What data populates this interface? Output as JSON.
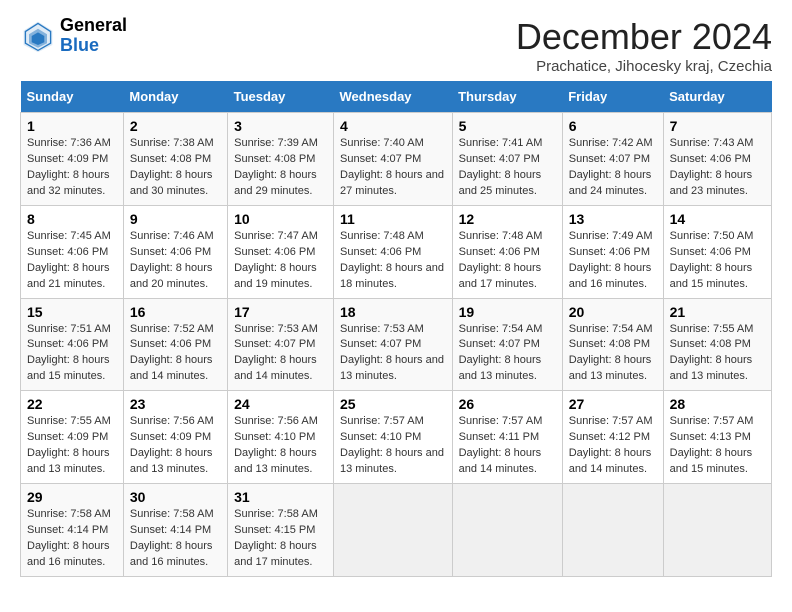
{
  "header": {
    "logo_general": "General",
    "logo_blue": "Blue",
    "month_title": "December 2024",
    "subtitle": "Prachatice, Jihocesky kraj, Czechia"
  },
  "calendar": {
    "days_of_week": [
      "Sunday",
      "Monday",
      "Tuesday",
      "Wednesday",
      "Thursday",
      "Friday",
      "Saturday"
    ],
    "weeks": [
      [
        {
          "day": "1",
          "sunrise": "Sunrise: 7:36 AM",
          "sunset": "Sunset: 4:09 PM",
          "daylight": "Daylight: 8 hours and 32 minutes."
        },
        {
          "day": "2",
          "sunrise": "Sunrise: 7:38 AM",
          "sunset": "Sunset: 4:08 PM",
          "daylight": "Daylight: 8 hours and 30 minutes."
        },
        {
          "day": "3",
          "sunrise": "Sunrise: 7:39 AM",
          "sunset": "Sunset: 4:08 PM",
          "daylight": "Daylight: 8 hours and 29 minutes."
        },
        {
          "day": "4",
          "sunrise": "Sunrise: 7:40 AM",
          "sunset": "Sunset: 4:07 PM",
          "daylight": "Daylight: 8 hours and 27 minutes."
        },
        {
          "day": "5",
          "sunrise": "Sunrise: 7:41 AM",
          "sunset": "Sunset: 4:07 PM",
          "daylight": "Daylight: 8 hours and 25 minutes."
        },
        {
          "day": "6",
          "sunrise": "Sunrise: 7:42 AM",
          "sunset": "Sunset: 4:07 PM",
          "daylight": "Daylight: 8 hours and 24 minutes."
        },
        {
          "day": "7",
          "sunrise": "Sunrise: 7:43 AM",
          "sunset": "Sunset: 4:06 PM",
          "daylight": "Daylight: 8 hours and 23 minutes."
        }
      ],
      [
        {
          "day": "8",
          "sunrise": "Sunrise: 7:45 AM",
          "sunset": "Sunset: 4:06 PM",
          "daylight": "Daylight: 8 hours and 21 minutes."
        },
        {
          "day": "9",
          "sunrise": "Sunrise: 7:46 AM",
          "sunset": "Sunset: 4:06 PM",
          "daylight": "Daylight: 8 hours and 20 minutes."
        },
        {
          "day": "10",
          "sunrise": "Sunrise: 7:47 AM",
          "sunset": "Sunset: 4:06 PM",
          "daylight": "Daylight: 8 hours and 19 minutes."
        },
        {
          "day": "11",
          "sunrise": "Sunrise: 7:48 AM",
          "sunset": "Sunset: 4:06 PM",
          "daylight": "Daylight: 8 hours and 18 minutes."
        },
        {
          "day": "12",
          "sunrise": "Sunrise: 7:48 AM",
          "sunset": "Sunset: 4:06 PM",
          "daylight": "Daylight: 8 hours and 17 minutes."
        },
        {
          "day": "13",
          "sunrise": "Sunrise: 7:49 AM",
          "sunset": "Sunset: 4:06 PM",
          "daylight": "Daylight: 8 hours and 16 minutes."
        },
        {
          "day": "14",
          "sunrise": "Sunrise: 7:50 AM",
          "sunset": "Sunset: 4:06 PM",
          "daylight": "Daylight: 8 hours and 15 minutes."
        }
      ],
      [
        {
          "day": "15",
          "sunrise": "Sunrise: 7:51 AM",
          "sunset": "Sunset: 4:06 PM",
          "daylight": "Daylight: 8 hours and 15 minutes."
        },
        {
          "day": "16",
          "sunrise": "Sunrise: 7:52 AM",
          "sunset": "Sunset: 4:06 PM",
          "daylight": "Daylight: 8 hours and 14 minutes."
        },
        {
          "day": "17",
          "sunrise": "Sunrise: 7:53 AM",
          "sunset": "Sunset: 4:07 PM",
          "daylight": "Daylight: 8 hours and 14 minutes."
        },
        {
          "day": "18",
          "sunrise": "Sunrise: 7:53 AM",
          "sunset": "Sunset: 4:07 PM",
          "daylight": "Daylight: 8 hours and 13 minutes."
        },
        {
          "day": "19",
          "sunrise": "Sunrise: 7:54 AM",
          "sunset": "Sunset: 4:07 PM",
          "daylight": "Daylight: 8 hours and 13 minutes."
        },
        {
          "day": "20",
          "sunrise": "Sunrise: 7:54 AM",
          "sunset": "Sunset: 4:08 PM",
          "daylight": "Daylight: 8 hours and 13 minutes."
        },
        {
          "day": "21",
          "sunrise": "Sunrise: 7:55 AM",
          "sunset": "Sunset: 4:08 PM",
          "daylight": "Daylight: 8 hours and 13 minutes."
        }
      ],
      [
        {
          "day": "22",
          "sunrise": "Sunrise: 7:55 AM",
          "sunset": "Sunset: 4:09 PM",
          "daylight": "Daylight: 8 hours and 13 minutes."
        },
        {
          "day": "23",
          "sunrise": "Sunrise: 7:56 AM",
          "sunset": "Sunset: 4:09 PM",
          "daylight": "Daylight: 8 hours and 13 minutes."
        },
        {
          "day": "24",
          "sunrise": "Sunrise: 7:56 AM",
          "sunset": "Sunset: 4:10 PM",
          "daylight": "Daylight: 8 hours and 13 minutes."
        },
        {
          "day": "25",
          "sunrise": "Sunrise: 7:57 AM",
          "sunset": "Sunset: 4:10 PM",
          "daylight": "Daylight: 8 hours and 13 minutes."
        },
        {
          "day": "26",
          "sunrise": "Sunrise: 7:57 AM",
          "sunset": "Sunset: 4:11 PM",
          "daylight": "Daylight: 8 hours and 14 minutes."
        },
        {
          "day": "27",
          "sunrise": "Sunrise: 7:57 AM",
          "sunset": "Sunset: 4:12 PM",
          "daylight": "Daylight: 8 hours and 14 minutes."
        },
        {
          "day": "28",
          "sunrise": "Sunrise: 7:57 AM",
          "sunset": "Sunset: 4:13 PM",
          "daylight": "Daylight: 8 hours and 15 minutes."
        }
      ],
      [
        {
          "day": "29",
          "sunrise": "Sunrise: 7:58 AM",
          "sunset": "Sunset: 4:14 PM",
          "daylight": "Daylight: 8 hours and 16 minutes."
        },
        {
          "day": "30",
          "sunrise": "Sunrise: 7:58 AM",
          "sunset": "Sunset: 4:14 PM",
          "daylight": "Daylight: 8 hours and 16 minutes."
        },
        {
          "day": "31",
          "sunrise": "Sunrise: 7:58 AM",
          "sunset": "Sunset: 4:15 PM",
          "daylight": "Daylight: 8 hours and 17 minutes."
        },
        null,
        null,
        null,
        null
      ]
    ]
  }
}
